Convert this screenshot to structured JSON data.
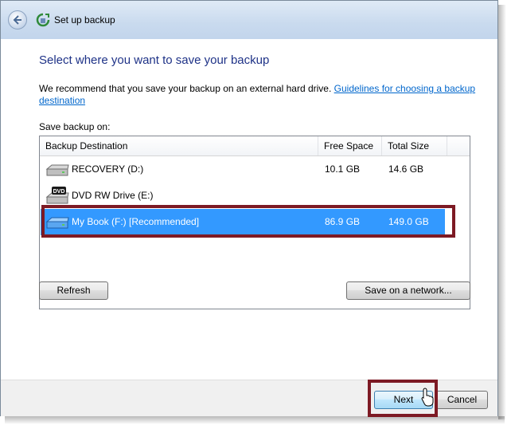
{
  "window": {
    "title": "Set up backup"
  },
  "page": {
    "heading": "Select where you want to save your backup",
    "intro_text": "We recommend that you save your backup on an external hard drive. ",
    "intro_link": "Guidelines for choosing a backup destination",
    "save_label": "Save backup on:"
  },
  "list": {
    "columns": [
      "Backup Destination",
      "Free Space",
      "Total Size"
    ],
    "rows": [
      {
        "name": "RECOVERY (D:)",
        "free": "10.1 GB",
        "total": "14.6 GB",
        "icon": "hard-drive-icon",
        "selected": false
      },
      {
        "name": "DVD RW Drive (E:)",
        "free": "",
        "total": "",
        "icon": "dvd-drive-icon",
        "selected": false
      },
      {
        "name": "My Book (F:) [Recommended]",
        "free": "86.9 GB",
        "total": "149.0 GB",
        "icon": "external-drive-icon",
        "selected": true
      }
    ]
  },
  "buttons": {
    "refresh": "Refresh",
    "save_network": "Save on a network...",
    "next": "Next",
    "cancel": "Cancel"
  },
  "colors": {
    "heading": "#1e3287",
    "link": "#0066cc",
    "selection": "#3399ff",
    "highlight_border": "#7d1a24"
  }
}
